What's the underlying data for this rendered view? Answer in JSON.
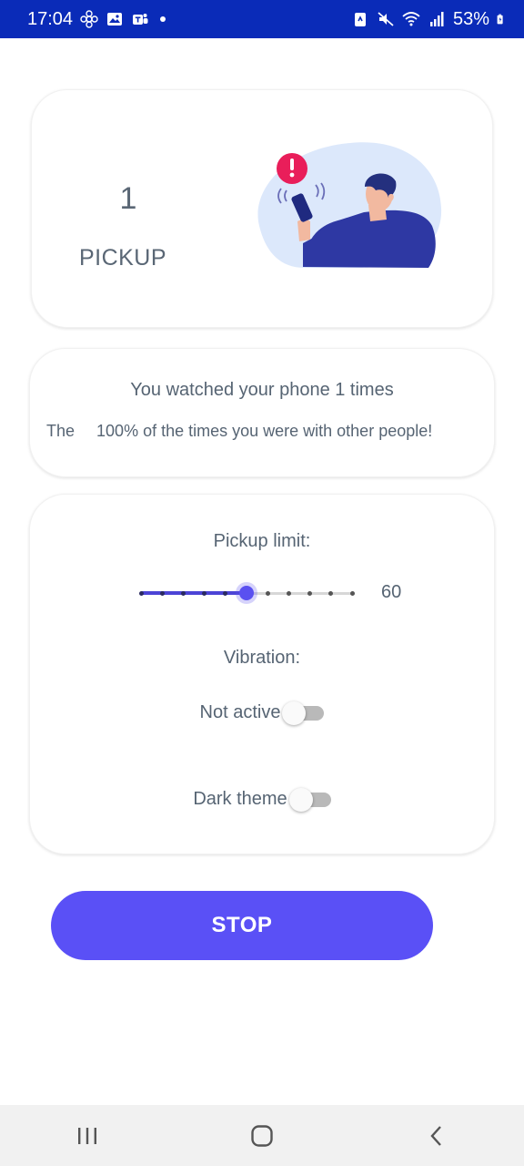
{
  "status_bar": {
    "time": "17:04",
    "battery": "53%",
    "icons_left": [
      "flower-icon",
      "image-icon",
      "teams-icon",
      "dot-icon"
    ],
    "icons_right": [
      "nfc-icon",
      "mute-icon",
      "wifi-icon",
      "signal-icon",
      "battery-icon"
    ]
  },
  "summary": {
    "count": "1",
    "label": "PICKUP"
  },
  "stats": {
    "watched_text": "You watched your phone 1  times",
    "people_prefix": "The",
    "people_text": "100% of the times you were with other people!"
  },
  "settings": {
    "pickup_limit_label": "Pickup limit:",
    "pickup_limit_value": "60",
    "slider": {
      "steps": 10,
      "selected_index": 5
    },
    "vibration_label": "Vibration:",
    "vibration_toggle_label": "Not active",
    "vibration_on": false,
    "dark_theme_label": "Dark theme",
    "dark_theme_on": false
  },
  "actions": {
    "stop_label": "STOP"
  },
  "colors": {
    "status_bar": "#0a2bb8",
    "accent": "#5a50f6",
    "text": "#566473",
    "alert": "#e91e5a"
  }
}
